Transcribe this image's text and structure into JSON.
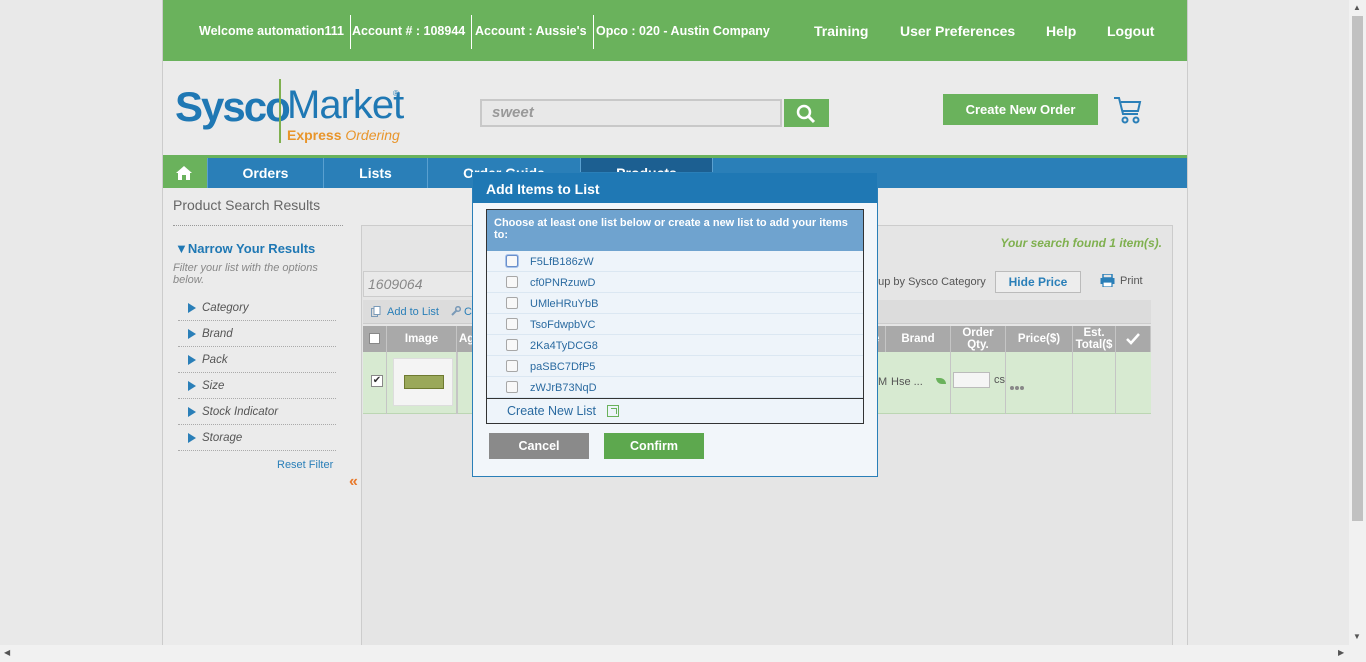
{
  "topbar": {
    "welcome": "Welcome automation111",
    "account_num": "Account # : 108944",
    "account_name": "Account : Aussie's",
    "opco": "Opco : 020 - Austin Company",
    "links": [
      "Training",
      "User Preferences",
      "Help",
      "Logout"
    ]
  },
  "header": {
    "logo_sysco": "Sysco",
    "logo_market": "Market",
    "logo_reg": "®",
    "logo_express": "Express",
    "logo_ordering": "Ordering",
    "search_value": "sweet",
    "create_order_label": "Create New Order"
  },
  "nav": {
    "items": [
      "Orders",
      "Lists",
      "Order Guide",
      "Products"
    ]
  },
  "sidebar": {
    "title": "Product Search Results",
    "narrow_title": "Narrow Your Results",
    "narrow_sub": "Filter your list with the options below.",
    "facets": [
      "Category",
      "Brand",
      "Pack",
      "Size",
      "Stock Indicator",
      "Storage"
    ],
    "reset_label": "Reset Filter",
    "collapse_glyph": "«"
  },
  "results": {
    "found_text": "Your search found 1 item(s).",
    "item_search_value": "1609064",
    "group_by_label": "oup by Sysco Category",
    "hide_price_label": "Hide Price",
    "print_label": "Print",
    "add_to_list_label": "Add to List",
    "copy_fragment": "C",
    "columns": {
      "image": "Image",
      "ag": "Ag",
      "e": "e",
      "brand": "Brand",
      "order_qty": "Order Qty.",
      "price": "Price($)",
      "est_total": "Est. Total($"
    },
    "row": {
      "checked_glyph": "✔",
      "m_fragment": "M",
      "brand": "Hse ...",
      "unit": "cs"
    }
  },
  "modal": {
    "title": "Add Items to List",
    "instruction": "Choose at least one list below or create a new list to add your items to:",
    "lists": [
      "F5LfB186zW",
      "cf0PNRzuwD",
      "UMleHRuYbB",
      "TsoFdwpbVC",
      "2Ka4TyDCG8",
      "paSBC7DfP5",
      "zWJrB73NqD"
    ],
    "create_new_list": "Create New List",
    "cancel_label": "Cancel",
    "confirm_label": "Confirm"
  },
  "colors": {
    "brand_green": "#6ab25c",
    "brand_blue": "#1f78b4",
    "nav_blue": "#2a7fb8",
    "accent_orange": "#e8952b"
  }
}
